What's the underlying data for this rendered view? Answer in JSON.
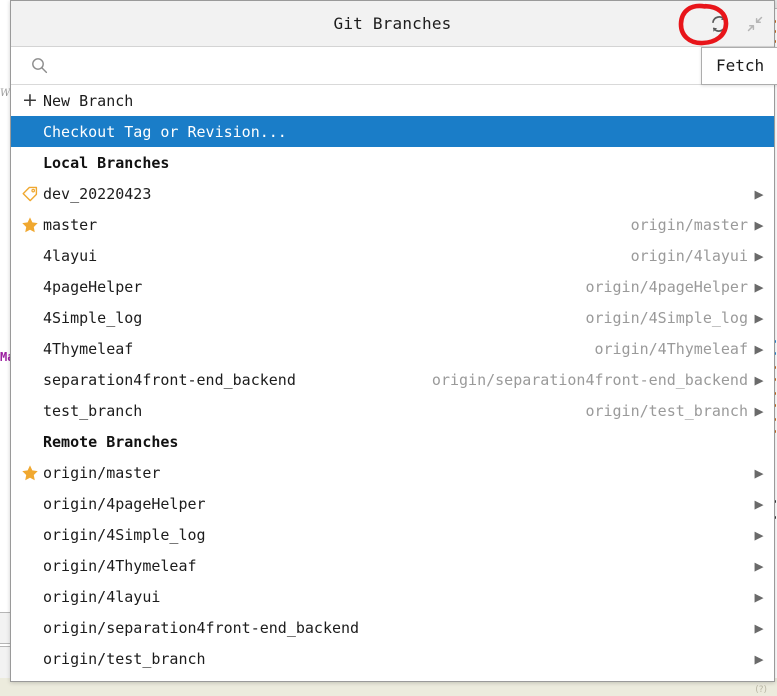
{
  "window": {
    "title": "Git Branches",
    "refresh_icon": "refresh-icon",
    "collapse_icon": "collapse-icon",
    "tooltip": "Fetch",
    "annotation_color": "#e8151a"
  },
  "search": {
    "value": "",
    "placeholder": "",
    "icon": "search-icon"
  },
  "actions": [
    {
      "label": "New Branch",
      "icon": "plus-icon",
      "selected": false
    },
    {
      "label": "Checkout Tag or Revision...",
      "icon": "none",
      "selected": true
    }
  ],
  "sections": [
    {
      "title": "Local Branches",
      "branches": [
        {
          "name": "dev_20220423",
          "icon": "tag-icon",
          "tracking": "",
          "arrow": true
        },
        {
          "name": "master",
          "icon": "star-icon",
          "tracking": "origin/master",
          "arrow": true
        },
        {
          "name": "4layui",
          "icon": "none",
          "tracking": "origin/4layui",
          "arrow": true
        },
        {
          "name": "4pageHelper",
          "icon": "none",
          "tracking": "origin/4pageHelper",
          "arrow": true
        },
        {
          "name": "4Simple_log",
          "icon": "none",
          "tracking": "origin/4Simple_log",
          "arrow": true
        },
        {
          "name": "4Thymeleaf",
          "icon": "none",
          "tracking": "origin/4Thymeleaf",
          "arrow": true
        },
        {
          "name": "separation4front-end_backend",
          "icon": "none",
          "tracking": "origin/separation4front-end_backend",
          "arrow": true
        },
        {
          "name": "test_branch",
          "icon": "none",
          "tracking": "origin/test_branch",
          "arrow": true
        }
      ]
    },
    {
      "title": "Remote Branches",
      "branches": [
        {
          "name": "origin/master",
          "icon": "star-icon",
          "tracking": "",
          "arrow": true
        },
        {
          "name": "origin/4pageHelper",
          "icon": "none",
          "tracking": "",
          "arrow": true
        },
        {
          "name": "origin/4Simple_log",
          "icon": "none",
          "tracking": "",
          "arrow": true
        },
        {
          "name": "origin/4Thymeleaf",
          "icon": "none",
          "tracking": "",
          "arrow": true
        },
        {
          "name": "origin/4layui",
          "icon": "none",
          "tracking": "",
          "arrow": true
        },
        {
          "name": "origin/separation4front-end_backend",
          "icon": "none",
          "tracking": "",
          "arrow": true
        },
        {
          "name": "origin/test_branch",
          "icon": "none",
          "tracking": "",
          "arrow": true
        }
      ]
    }
  ],
  "background": {
    "gutter_note": "Wr",
    "code_fragment": "Ma",
    "status_tick": "(?)",
    "accent_selected": "#1a7dc8",
    "star_color": "#f0a830",
    "strip_color": "#ecebdd"
  }
}
